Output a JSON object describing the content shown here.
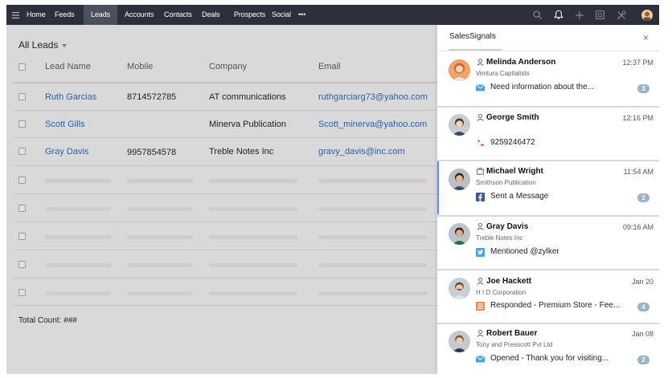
{
  "nav": {
    "items": [
      {
        "label": "Home"
      },
      {
        "label": "Feeds"
      },
      {
        "label": "Leads",
        "active": true
      },
      {
        "label": "Accounts"
      },
      {
        "label": "Contacts"
      },
      {
        "label": "Deals"
      },
      {
        "label": "Prospects"
      },
      {
        "label": "Social"
      }
    ],
    "more_label": "•••"
  },
  "leads": {
    "title": "All Leads",
    "columns": [
      "Lead Name",
      "Mobile",
      "Company",
      "Email"
    ],
    "rows": [
      {
        "name": "Ruth Garcias",
        "mobile": "8714572785",
        "company": "AT communications",
        "email": "ruthgarciarg73@yahoo.com"
      },
      {
        "name": "Scott Gills",
        "mobile": "",
        "company": "Minerva Publication",
        "email": "Scott_minerva@yahoo.com"
      },
      {
        "name": "Gray Davis",
        "mobile": "9957854578",
        "company": "Treble Notes Inc",
        "email": "gravy_davis@inc.com"
      }
    ],
    "total_label": "Total Count: ###"
  },
  "sales_signals": {
    "title": "SalesSignals",
    "close_label": "×",
    "items": [
      {
        "name": "Melinda Anderson",
        "time": "12:37 PM",
        "company": "Ventura Capitalists",
        "channel": "email-icon",
        "message": "Need information about the...",
        "count": "3",
        "contact_type": "lead"
      },
      {
        "name": "George Smith",
        "time": "12:16 PM",
        "company": "",
        "channel": "phone-icon",
        "message": "9259246472",
        "count": "",
        "contact_type": "lead"
      },
      {
        "name": "Michael Wright",
        "time": "11:54 AM",
        "company": "Smithson Publication",
        "channel": "facebook-icon",
        "message": "Sent a Message",
        "count": "2",
        "contact_type": "contact"
      },
      {
        "name": "Gray Davis",
        "time": "09:16 AM",
        "company": "Treble Notes Inc",
        "channel": "twitter-icon",
        "message": "Mentioned @zylker",
        "count": "",
        "contact_type": "lead"
      },
      {
        "name": "Joe Hackett",
        "time": "Jan 20",
        "company": "H I D Corporation",
        "channel": "survey-icon",
        "message": "Responded - Premium Store - Fee...",
        "count": "4",
        "contact_type": "lead"
      },
      {
        "name": "Robert Bauer",
        "time": "Jan 08",
        "company": "Tony and Presscott Pvt Ltd",
        "channel": "email-icon",
        "message": "Opened - Thank you for visiting...",
        "count": "2",
        "contact_type": "lead"
      }
    ]
  },
  "colors": {
    "nav_bg": "#2b303b",
    "link": "#2a5fa8",
    "active_signal": "#5b8def",
    "badge": "#9eb2c8"
  }
}
